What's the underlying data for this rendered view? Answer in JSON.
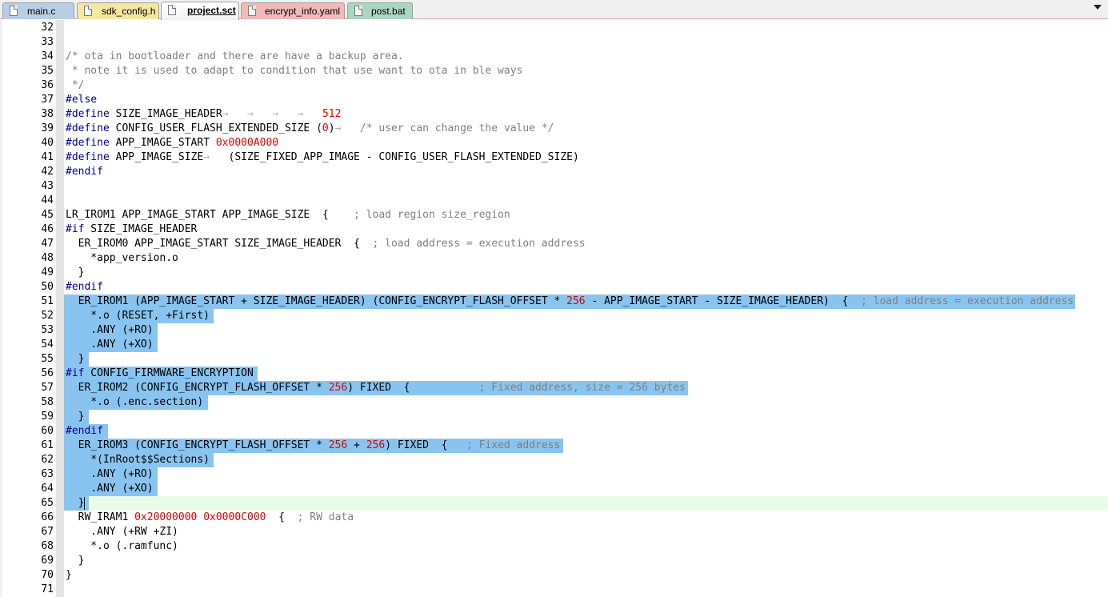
{
  "tabs": [
    {
      "label": "main.c",
      "color": "#b8cde6",
      "active": false
    },
    {
      "label": "sdk_config.h",
      "color": "#f5e6a0",
      "active": false
    },
    {
      "label": "project.sct",
      "color": "#f3b8b8",
      "active": true
    },
    {
      "label": "encrypt_info.yaml",
      "color": "#f3b8b8",
      "active": false
    },
    {
      "label": "post.bat",
      "color": "#a8d8c0",
      "active": false
    }
  ],
  "editor": {
    "selection_color": "#89c4f0",
    "current_line_color": "#e8fbe8",
    "selected_lines": [
      51,
      65
    ],
    "current_line": 65,
    "lines": [
      {
        "n": "32",
        "text": ""
      },
      {
        "n": "33",
        "text": ""
      },
      {
        "n": "34",
        "text": "/* ota in bootloader and there are have a backup area. "
      },
      {
        "n": "35",
        "text": " * note it is used to adapt to condition that use want to ota in ble ways"
      },
      {
        "n": "36",
        "text": " */"
      },
      {
        "n": "37",
        "text": "#else"
      },
      {
        "n": "38",
        "text": "#define SIZE_IMAGE_HEADER\t\t\t\t512"
      },
      {
        "n": "39",
        "text": "#define CONFIG_USER_FLASH_EXTENDED_SIZE (0)\t/* user can change the value */"
      },
      {
        "n": "40",
        "text": "#define APP_IMAGE_START 0x0000A000"
      },
      {
        "n": "41",
        "text": "#define APP_IMAGE_SIZE\t(SIZE_FIXED_APP_IMAGE - CONFIG_USER_FLASH_EXTENDED_SIZE)"
      },
      {
        "n": "42",
        "text": "#endif"
      },
      {
        "n": "43",
        "text": ""
      },
      {
        "n": "44",
        "text": ""
      },
      {
        "n": "45",
        "text": "LR_IROM1 APP_IMAGE_START APP_IMAGE_SIZE  {    ; load region size_region"
      },
      {
        "n": "46",
        "text": "#if SIZE_IMAGE_HEADER"
      },
      {
        "n": "47",
        "text": "  ER_IROM0 APP_IMAGE_START SIZE_IMAGE_HEADER  {  ; load address = execution address"
      },
      {
        "n": "48",
        "text": "    *app_version.o"
      },
      {
        "n": "49",
        "text": "  }"
      },
      {
        "n": "50",
        "text": "#endif"
      },
      {
        "n": "51",
        "text": "  ER_IROM1 (APP_IMAGE_START + SIZE_IMAGE_HEADER) (CONFIG_ENCRYPT_FLASH_OFFSET * 256 - APP_IMAGE_START - SIZE_IMAGE_HEADER)  {  ; load address = execution address"
      },
      {
        "n": "52",
        "text": "    *.o (RESET, +First)"
      },
      {
        "n": "53",
        "text": "    .ANY (+RO)"
      },
      {
        "n": "54",
        "text": "    .ANY (+XO)"
      },
      {
        "n": "55",
        "text": "  }"
      },
      {
        "n": "56",
        "text": "#if CONFIG_FIRMWARE_ENCRYPTION"
      },
      {
        "n": "57",
        "text": "  ER_IROM2 (CONFIG_ENCRYPT_FLASH_OFFSET * 256) FIXED  {           ; Fixed address, size = 256 bytes"
      },
      {
        "n": "58",
        "text": "    *.o (.enc.section)"
      },
      {
        "n": "59",
        "text": "  }"
      },
      {
        "n": "60",
        "text": "#endif"
      },
      {
        "n": "61",
        "text": "  ER_IROM3 (CONFIG_ENCRYPT_FLASH_OFFSET * 256 + 256) FIXED  {   ; Fixed address"
      },
      {
        "n": "62",
        "text": "    *(InRoot$$Sections)"
      },
      {
        "n": "63",
        "text": "    .ANY (+RO)"
      },
      {
        "n": "64",
        "text": "    .ANY (+XO)"
      },
      {
        "n": "65",
        "text": "  }"
      },
      {
        "n": "66",
        "text": "  RW_IRAM1 0x20000000 0x0000C000  {  ; RW data"
      },
      {
        "n": "67",
        "text": "    .ANY (+RW +ZI)"
      },
      {
        "n": "68",
        "text": "    *.o (.ramfunc)"
      },
      {
        "n": "69",
        "text": "  }"
      },
      {
        "n": "70",
        "text": "}"
      },
      {
        "n": "71",
        "text": ""
      }
    ]
  }
}
